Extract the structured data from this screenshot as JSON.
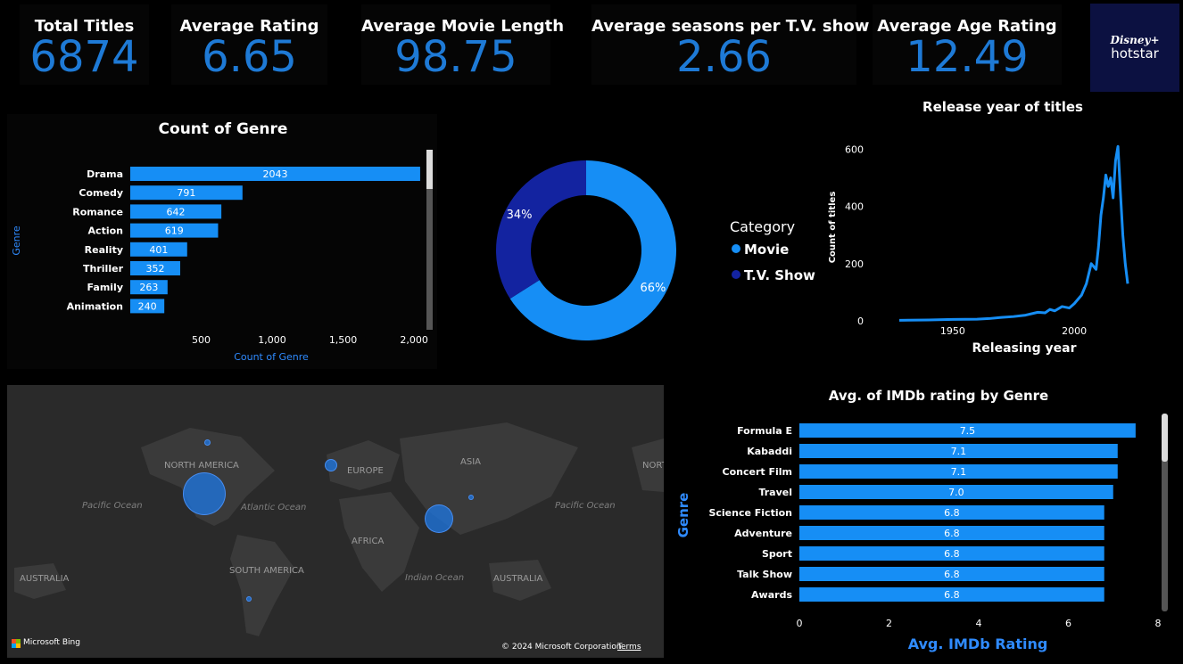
{
  "kpis": [
    {
      "label": "Total Titles",
      "value": "6874"
    },
    {
      "label": "Average Rating",
      "value": "6.65"
    },
    {
      "label": "Average Movie Length",
      "value": "98.75"
    },
    {
      "label": "Average seasons per T.V. show",
      "value": "2.66"
    },
    {
      "label": "Average Age Rating",
      "value": "12.49"
    }
  ],
  "logo": {
    "line1": "Disney+",
    "line2": "hotstar"
  },
  "colors": {
    "accent": "#1e7ad6",
    "bar": "#168ef5",
    "movie": "#168ef5",
    "tvshow": "#1323a0",
    "background": "#000000"
  },
  "map": {
    "labels": {
      "north_america": "NORTH AMERICA",
      "europe": "EUROPE",
      "asia": "ASIA",
      "africa": "AFRICA",
      "south_america": "SOUTH AMERICA",
      "australia_left": "AUSTRALIA",
      "australia_right": "AUSTRALIA",
      "pacific_left": "Pacific Ocean",
      "pacific_right": "Pacific Ocean",
      "atlantic": "Atlantic Ocean",
      "indian": "Indian Ocean",
      "nort": "NORT"
    },
    "attribution_left": "Microsoft Bing",
    "attribution_right": "© 2024 Microsoft Corporation",
    "terms": "Terms"
  },
  "chart_data": [
    {
      "type": "bar",
      "orientation": "horizontal",
      "title": "Count of Genre",
      "ylabel": "Genre",
      "xlabel": "Count of Genre",
      "categories": [
        "Drama",
        "Comedy",
        "Romance",
        "Action",
        "Reality",
        "Thriller",
        "Family",
        "Animation"
      ],
      "values": [
        2043,
        791,
        642,
        619,
        401,
        352,
        263,
        240
      ],
      "data_labels": [
        "2043",
        "791",
        "642",
        "619",
        "401",
        "352",
        "263",
        "240"
      ],
      "xticks": [
        "500",
        "1,000",
        "1,500",
        "2,000"
      ],
      "xlim": [
        0,
        2100
      ]
    },
    {
      "type": "pie",
      "donut": true,
      "legend_title": "Category",
      "categories": [
        "Movie",
        "T.V. Show"
      ],
      "values": [
        66,
        34
      ],
      "data_labels": [
        "66%",
        "34%"
      ],
      "legend_position": "right"
    },
    {
      "type": "line",
      "title": "Release year of titles",
      "xlabel": "Releasing year",
      "ylabel": "Count of titles",
      "x": [
        1928,
        1940,
        1950,
        1960,
        1965,
        1970,
        1975,
        1980,
        1985,
        1988,
        1990,
        1992,
        1995,
        1998,
        2000,
        2003,
        2005,
        2007,
        2009,
        2010,
        2011,
        2012,
        2013,
        2014,
        2015,
        2016,
        2017,
        2018,
        2019,
        2020,
        2021,
        2022
      ],
      "y": [
        2,
        3,
        5,
        6,
        8,
        12,
        15,
        20,
        30,
        28,
        40,
        35,
        50,
        45,
        60,
        90,
        130,
        200,
        180,
        260,
        370,
        430,
        510,
        470,
        500,
        430,
        560,
        610,
        450,
        300,
        200,
        130
      ],
      "xticks": [
        "1950",
        "2000"
      ],
      "yticks": [
        "0",
        "200",
        "400",
        "600"
      ],
      "ylim": [
        0,
        650
      ]
    },
    {
      "type": "bar",
      "orientation": "horizontal",
      "title": "Avg. of IMDb rating by Genre",
      "ylabel": "Genre",
      "xlabel": "Avg. IMDb Rating",
      "categories": [
        "Formula E",
        "Kabaddi",
        "Concert Film",
        "Travel",
        "Science Fiction",
        "Adventure",
        "Sport",
        "Talk Show",
        "Awards"
      ],
      "values": [
        7.5,
        7.1,
        7.1,
        7.0,
        6.8,
        6.8,
        6.8,
        6.8,
        6.8
      ],
      "data_labels": [
        "7.5",
        "7.1",
        "7.1",
        "7.0",
        "6.8",
        "6.8",
        "6.8",
        "6.8",
        "6.8"
      ],
      "xticks": [
        "0",
        "2",
        "4",
        "6",
        "8"
      ],
      "xlim": [
        0,
        8
      ]
    }
  ]
}
